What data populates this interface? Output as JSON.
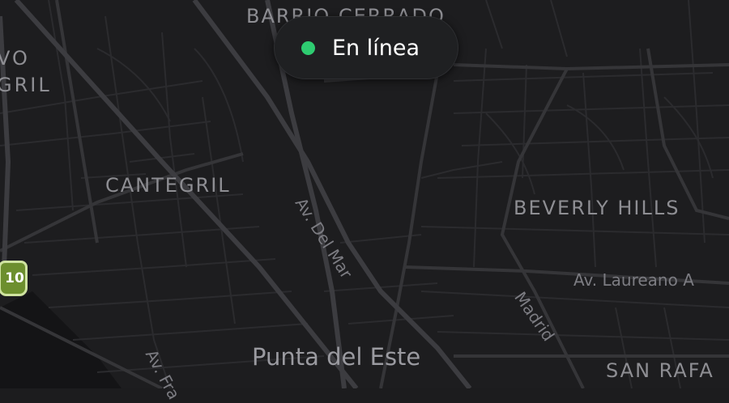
{
  "status": {
    "label": "En línea",
    "dot_color": "#2ecc71",
    "pill_color": "#1f2022"
  },
  "map": {
    "theme": "dark",
    "background_color": "#1d1d1f",
    "districts": [
      {
        "id": "barrio-cerrado",
        "text": "BARRIO CERRADO"
      },
      {
        "id": "nuevo-cantegril",
        "text": "VO GRIL"
      },
      {
        "id": "cantegril",
        "text": "CANTEGRIL"
      },
      {
        "id": "beverly-hills",
        "text": "BEVERLY HILLS"
      },
      {
        "id": "san-rafael",
        "text": "SAN RAFA"
      }
    ],
    "streets": [
      {
        "id": "av-del-mar",
        "text": "Av. Del Mar"
      },
      {
        "id": "av-laureano",
        "text": "Av. Laureano A"
      },
      {
        "id": "madrid",
        "text": "Madrid"
      },
      {
        "id": "av-francia",
        "text": "Av. Fra"
      }
    ],
    "city": {
      "text": "Punta del Este"
    },
    "route_shield": {
      "number": "10",
      "color": "#6d8f2e"
    }
  }
}
